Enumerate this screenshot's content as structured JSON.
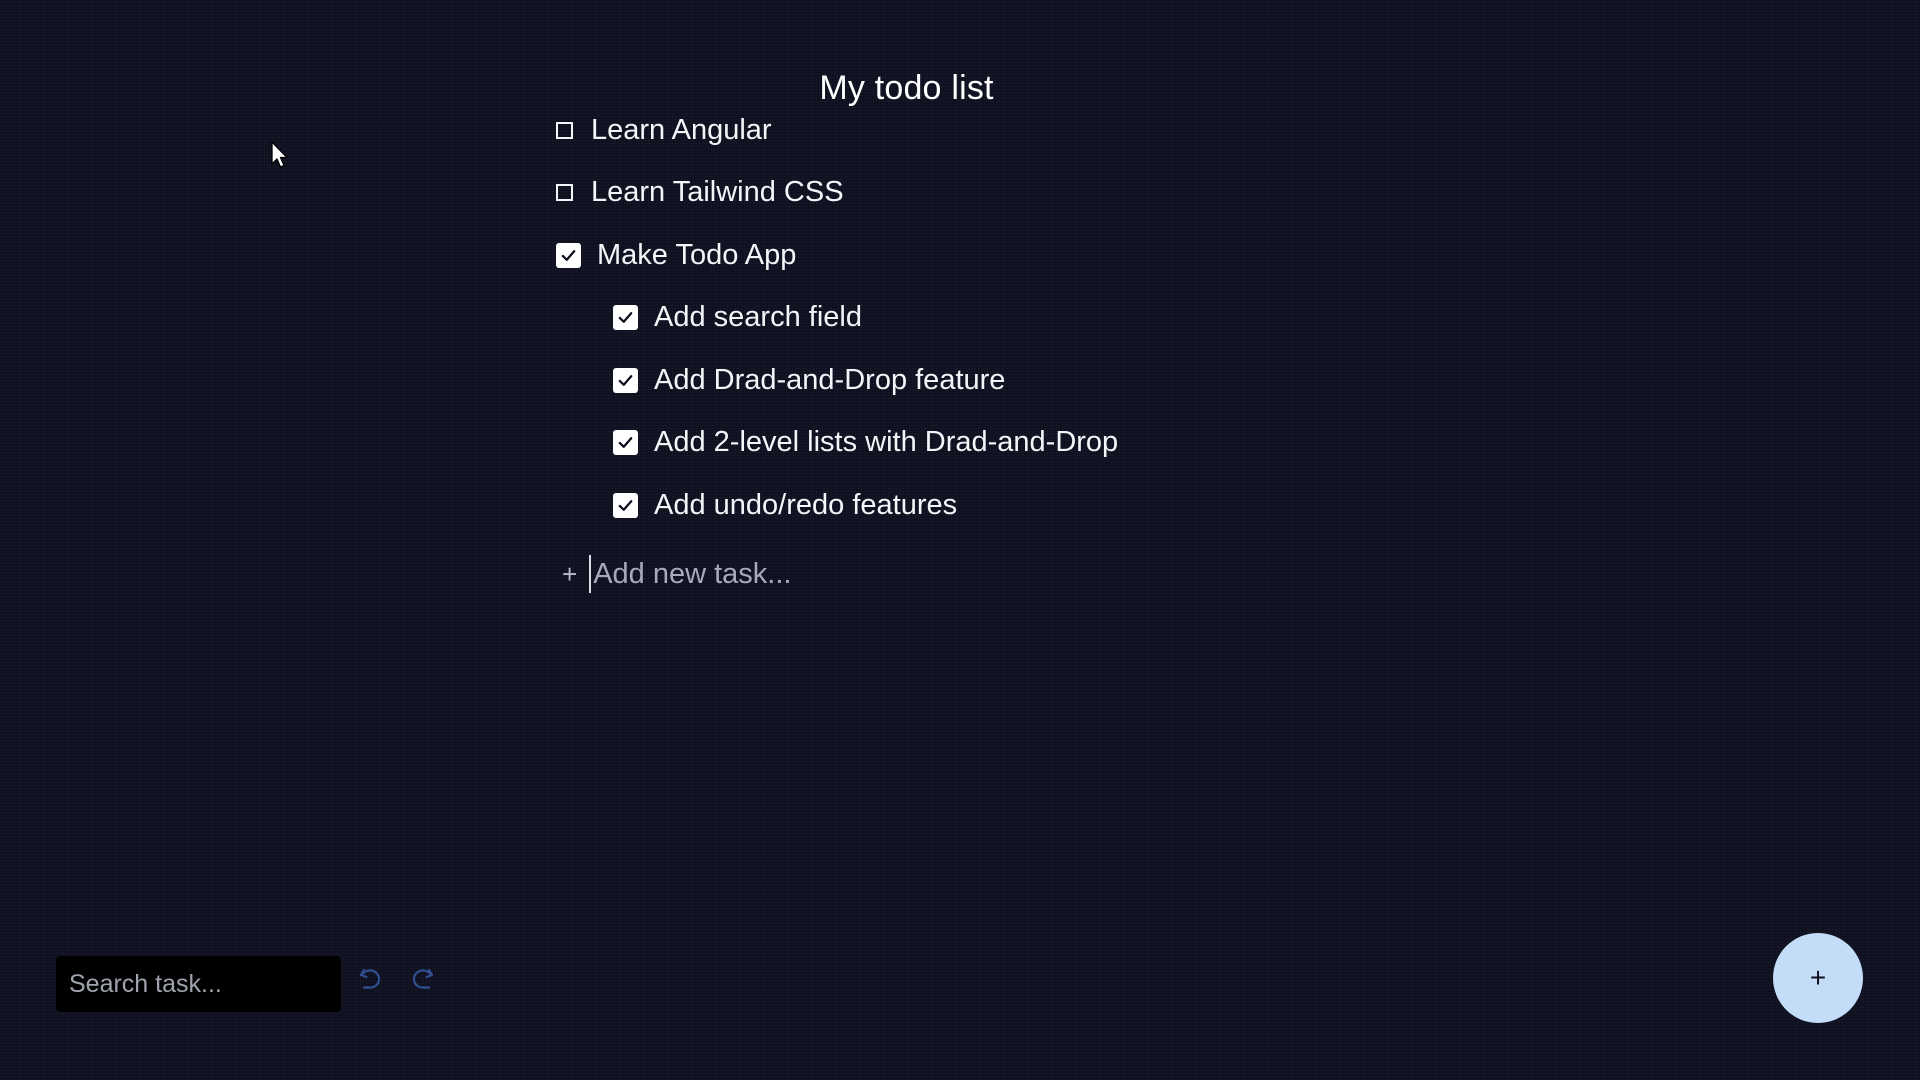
{
  "page": {
    "title": "My todo list"
  },
  "todos": [
    {
      "label": "Learn Angular",
      "checked": false,
      "level": 1
    },
    {
      "label": "Learn Tailwind CSS",
      "checked": false,
      "level": 1
    },
    {
      "label": "Make Todo App",
      "checked": true,
      "level": 1
    },
    {
      "label": "Add search field",
      "checked": true,
      "level": 2
    },
    {
      "label": "Add Drad-and-Drop feature",
      "checked": true,
      "level": 2
    },
    {
      "label": "Add 2-level lists with Drad-and-Drop",
      "checked": true,
      "level": 2
    },
    {
      "label": "Add undo/redo features",
      "checked": true,
      "level": 2
    }
  ],
  "add_task": {
    "icon": "plus",
    "placeholder": "Add new task..."
  },
  "toolbar": {
    "search_placeholder": "Search task...",
    "undo_icon": "undo-icon",
    "redo_icon": "redo-icon",
    "history_icon_color": "#2f4f8f"
  },
  "fab": {
    "label": "+",
    "color": "#c3dcf7"
  }
}
